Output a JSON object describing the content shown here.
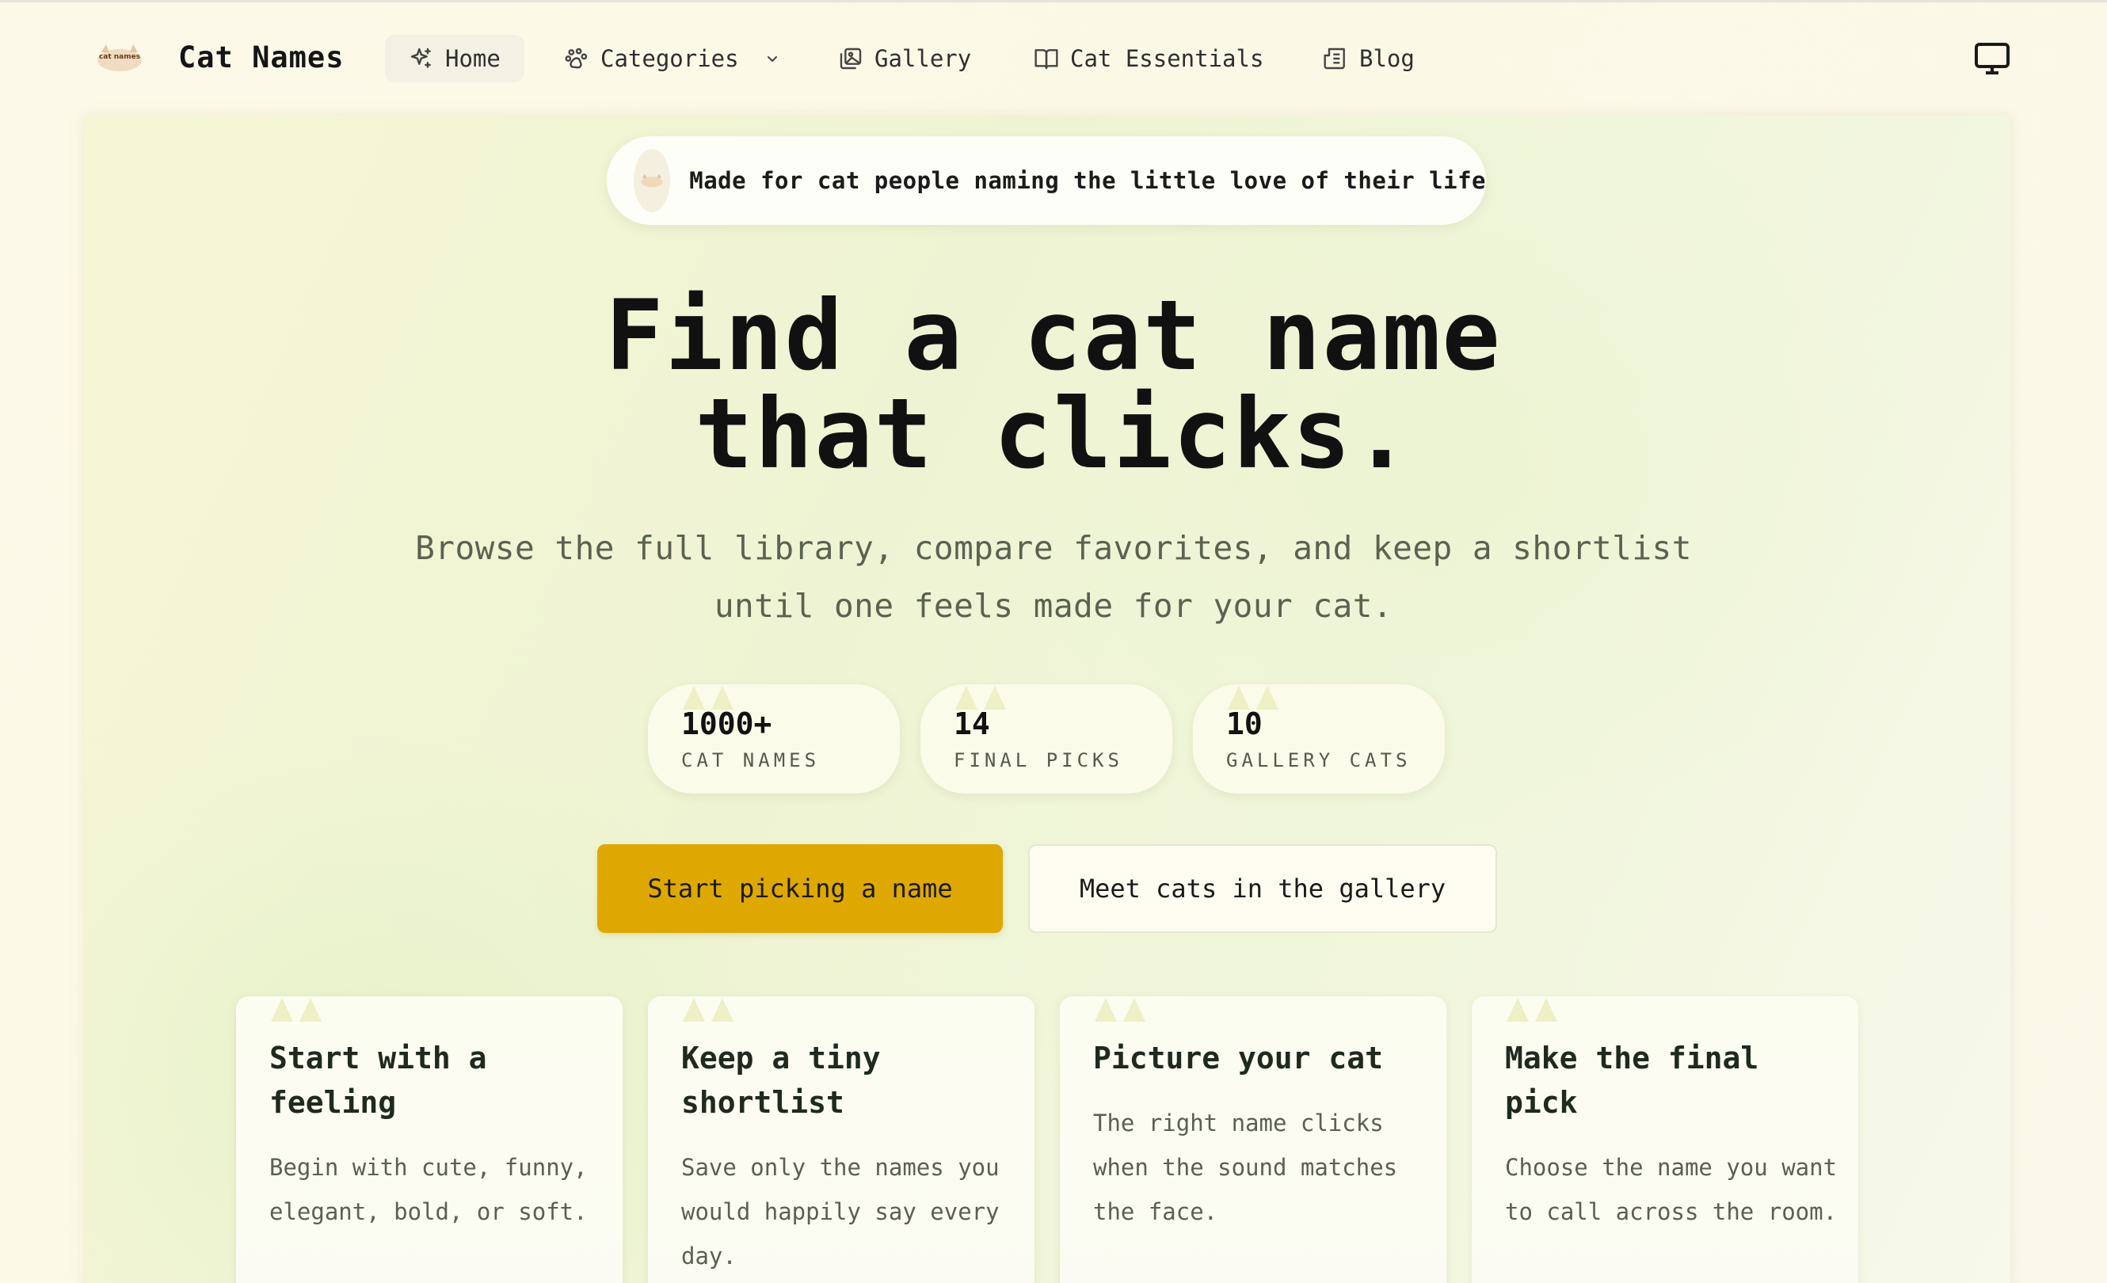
{
  "header": {
    "brand": "Cat Names",
    "logo_text": "cat names",
    "nav": [
      {
        "label": "Home",
        "icon": "sparkles-icon",
        "active": true
      },
      {
        "label": "Categories",
        "icon": "paw-icon",
        "has_dropdown": true
      },
      {
        "label": "Gallery",
        "icon": "gallery-icon"
      },
      {
        "label": "Cat Essentials",
        "icon": "book-icon"
      },
      {
        "label": "Blog",
        "icon": "newspaper-icon"
      }
    ],
    "theme_icon": "monitor-icon"
  },
  "hero": {
    "pill_text": "Made for cat people naming the little love of their life",
    "title_line1": "Find a cat name",
    "title_line2": "that clicks.",
    "subtitle": "Browse the full library, compare favorites, and keep a shortlist until one feels made for your cat.",
    "stats": [
      {
        "value": "1000+",
        "label": "CAT NAMES"
      },
      {
        "value": "14",
        "label": "FINAL PICKS"
      },
      {
        "value": "10",
        "label": "GALLERY CATS"
      }
    ],
    "primary_button": "Start picking a name",
    "secondary_button": "Meet cats in the gallery"
  },
  "cards": [
    {
      "title": "Start with a feeling",
      "text": "Begin with cute, funny, elegant, bold, or soft."
    },
    {
      "title": "Keep a tiny shortlist",
      "text": "Save only the names you would happily say every day."
    },
    {
      "title": "Picture your cat",
      "text": "The right name clicks when the sound matches the face."
    },
    {
      "title": "Make the final pick",
      "text": "Choose the name you want to call across the room."
    }
  ],
  "colors": {
    "accent": "#dfa800",
    "background": "#fbf9e6",
    "hero_tint": "#eef4d3",
    "ear": "#eef0c8"
  }
}
